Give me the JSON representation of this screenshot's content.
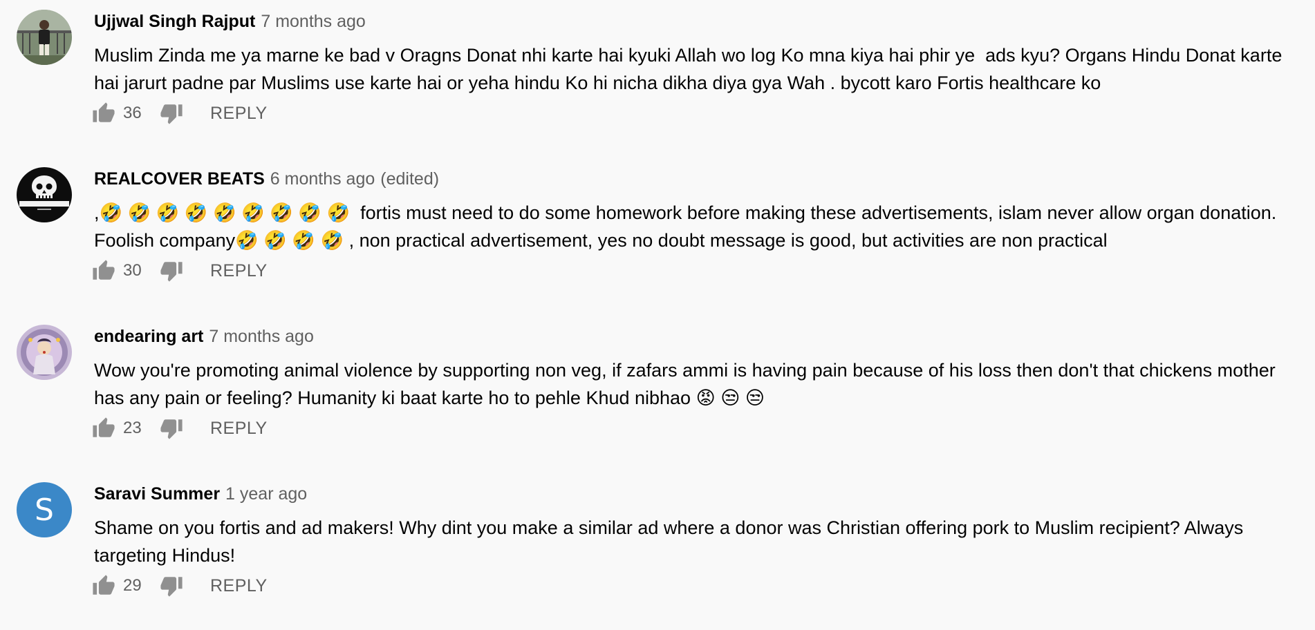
{
  "comments": [
    {
      "author": "Ujjwal Singh Rajput",
      "time": "7 months ago",
      "edited": "",
      "text": "Muslim Zinda me ya marne ke bad v Oragns Donat nhi karte hai kyuki Allah wo log Ko mna kiya hai phir ye  ads kyu? Organs Hindu Donat karte hai jarurt padne par Muslims use karte hai or yeha hindu Ko hi nicha dikha diya gya Wah . bycott karo Fortis healthcare ko",
      "likes": "36",
      "reply_label": "REPLY",
      "avatar": {
        "type": "photo",
        "colors": [
          "#6f7f66",
          "#c9ccc0",
          "#2b2b2b"
        ]
      }
    },
    {
      "author": "REALCOVER BEATS",
      "time": "6 months ago",
      "edited": "(edited)",
      "text": ",🤣 🤣 🤣 🤣 🤣 🤣 🤣 🤣 🤣  fortis must need to do some homework before making these advertisements, islam never allow organ donation. Foolish company🤣 🤣 🤣 🤣 , non practical advertisement, yes no doubt message is good, but activities are non practical",
      "likes": "30",
      "reply_label": "REPLY",
      "avatar": {
        "type": "logo",
        "colors": [
          "#111111",
          "#ffffff"
        ]
      }
    },
    {
      "author": "endearing art",
      "time": "7 months ago",
      "edited": "",
      "text": "Wow you're promoting animal violence by supporting non veg, if zafars ammi is having pain because of his loss then don't that chickens mother has any pain or feeling? Humanity ki baat karte ho to pehle Khud nibhao 😡 😒 😒",
      "likes": "23",
      "reply_label": "REPLY",
      "avatar": {
        "type": "photo",
        "colors": [
          "#b8a9c9",
          "#e6d2b5",
          "#7a6a8c"
        ]
      }
    },
    {
      "author": "Saravi Summer",
      "time": "1 year ago",
      "edited": "",
      "text": "Shame on you fortis and ad makers! Why dint you make a similar ad where a donor was Christian offering pork to Muslim recipient? Always targeting Hindus!",
      "likes": "29",
      "reply_label": "REPLY",
      "avatar": {
        "type": "letter",
        "letter": "S",
        "colors": [
          "#3b88c8"
        ]
      }
    }
  ]
}
